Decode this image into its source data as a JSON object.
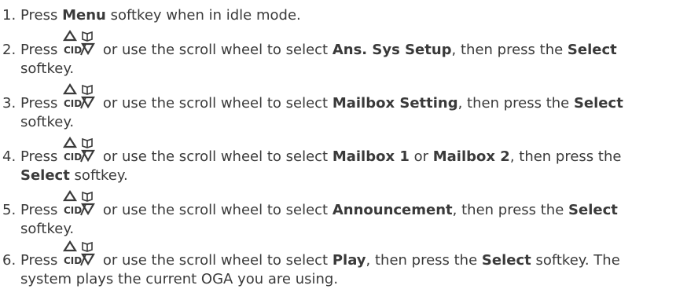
{
  "steps": [
    {
      "num": "1.",
      "parts": [
        {
          "t": "Press "
        },
        {
          "b": "Menu"
        },
        {
          "t": " softkey when in idle mode."
        }
      ]
    },
    {
      "num": "2.",
      "parts": [
        {
          "t": "Press "
        },
        {
          "icon": "up-cid-down-book-keys-icon"
        },
        {
          "t": " or use the scroll wheel to select "
        },
        {
          "b": "Ans. Sys Setup"
        },
        {
          "t": ", then press the "
        },
        {
          "b": "Select"
        },
        {
          "br": true
        },
        {
          "t": "softkey."
        }
      ]
    },
    {
      "num": "3.",
      "parts": [
        {
          "t": "Press "
        },
        {
          "icon": "up-cid-down-book-keys-icon"
        },
        {
          "t": " or use the scroll wheel to select "
        },
        {
          "b": "Mailbox Setting"
        },
        {
          "t": ", then press the "
        },
        {
          "b": "Select"
        },
        {
          "br": true
        },
        {
          "t": "softkey."
        }
      ]
    },
    {
      "num": "4.",
      "parts": [
        {
          "t": "Press "
        },
        {
          "icon": "up-cid-down-book-keys-icon"
        },
        {
          "t": " or use the scroll wheel to select "
        },
        {
          "b": "Mailbox 1"
        },
        {
          "t": " or "
        },
        {
          "b": "Mailbox 2"
        },
        {
          "t": ", then press the"
        },
        {
          "br": true
        },
        {
          "b": "Select"
        },
        {
          "t": " softkey."
        }
      ]
    },
    {
      "num": "5.",
      "parts": [
        {
          "t": "Press "
        },
        {
          "icon": "up-cid-down-book-keys-icon"
        },
        {
          "t": " or use the scroll wheel to select "
        },
        {
          "b": "Announcement"
        },
        {
          "t": ", then press the "
        },
        {
          "b": "Select"
        },
        {
          "br": true
        },
        {
          "t": "softkey."
        }
      ]
    },
    {
      "num": "6.",
      "parts": [
        {
          "t": "Press "
        },
        {
          "icon": "up-cid-down-book-keys-icon"
        },
        {
          "t": " or use the scroll wheel to select "
        },
        {
          "b": "Play"
        },
        {
          "t": ", then press the "
        },
        {
          "b": "Select"
        },
        {
          "t": " softkey. The"
        },
        {
          "br": true
        },
        {
          "t": "system plays the current OGA you are using."
        }
      ]
    }
  ],
  "icon_label": "CID"
}
